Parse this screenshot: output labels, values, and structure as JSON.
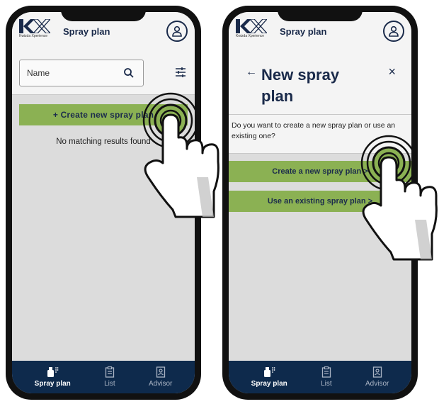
{
  "brand": {
    "logo_sub": "Kwizda Xperience"
  },
  "left_screen": {
    "title": "Spray plan",
    "search_placeholder": "Name",
    "create_button": "+ Create new spray plan",
    "no_results": "No matching results found"
  },
  "right_screen": {
    "title": "Spray plan",
    "back_arrow": "←",
    "dialog_title": "New spray plan",
    "close_symbol": "×",
    "question": "Do you want to create a new spray plan or use an existing one?",
    "option_new": "Create a new spray plan >",
    "option_existing": "Use an existing spray plan >"
  },
  "nav": {
    "items": [
      {
        "label": "Spray plan",
        "icon": "spray-icon",
        "active": true
      },
      {
        "label": "List",
        "icon": "clipboard-icon",
        "active": false
      },
      {
        "label": "Advisor",
        "icon": "advisor-icon",
        "active": false
      }
    ]
  },
  "colors": {
    "accent": "#8bb153",
    "navy": "#0e2a4c",
    "background": "#dcdcdc"
  }
}
